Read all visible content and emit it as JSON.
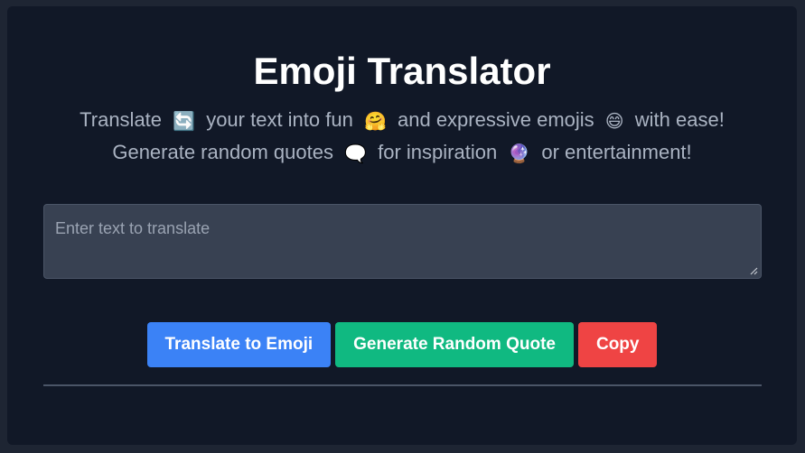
{
  "app": {
    "title": "Emoji Translator",
    "subtitle_line1": {
      "part1": "Translate",
      "emoji1": "🔄",
      "part2": "your text into fun",
      "emoji2": "🤗",
      "part3": "and expressive emojis",
      "emoji3": "😄",
      "part4": "with ease!"
    },
    "subtitle_line2": {
      "part1": "Generate random quotes",
      "emoji1": "🗨️",
      "part2": "for inspiration",
      "emoji2": "🔮",
      "part3": "or entertainment!"
    }
  },
  "input": {
    "placeholder": "Enter text to translate",
    "value": ""
  },
  "buttons": {
    "translate_label": "Translate to Emoji",
    "quote_label": "Generate Random Quote",
    "copy_label": "Copy"
  },
  "colors": {
    "background": "#111827",
    "translate_button": "#3b82f6",
    "quote_button": "#10b981",
    "copy_button": "#ef4444"
  }
}
